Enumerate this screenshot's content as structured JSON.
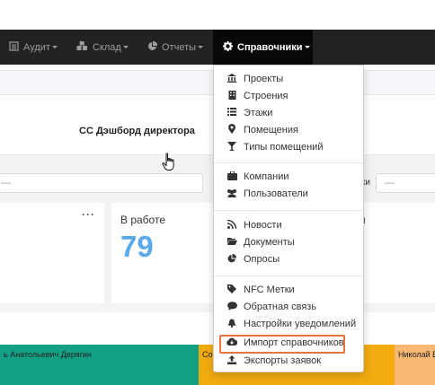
{
  "navbar": {
    "items": [
      {
        "label": "Аудит",
        "icon": "audit-icon"
      },
      {
        "label": "Склад",
        "icon": "warehouse-icon"
      },
      {
        "label": "Отчеты",
        "icon": "pie-chart-icon"
      },
      {
        "label": "Справочники",
        "icon": "gear-icon",
        "active": true
      }
    ]
  },
  "dashboard": {
    "title": "СС Дэшборд директора",
    "filter_left_value": "—",
    "filter_right_label": "ки",
    "filter_right_value": "—"
  },
  "cards": {
    "in_work_label": "В работе",
    "in_work_value": "79",
    "third_card_label_fragment": "ы",
    "menu_dots": "···"
  },
  "bars": [
    {
      "label": "ь Анатольевич Дерягин",
      "color": "#14a085"
    },
    {
      "label": "Со",
      "color": "#f2ac10"
    },
    {
      "label": "Николай Е",
      "color": "#f6b872"
    }
  ],
  "dropdown": {
    "items": [
      {
        "label": "Проекты",
        "icon": "institution-icon"
      },
      {
        "label": "Строения",
        "icon": "building-icon"
      },
      {
        "label": "Этажи",
        "icon": "list-icon"
      },
      {
        "label": "Помещения",
        "icon": "map-marker-icon"
      },
      {
        "label": "Типы помещений",
        "icon": "glass-icon"
      },
      {
        "label": "Компании",
        "icon": "briefcase-icon"
      },
      {
        "label": "Пользователи",
        "icon": "users-icon"
      },
      {
        "label": "Новости",
        "icon": "rss-icon"
      },
      {
        "label": "Документы",
        "icon": "folder-open-icon"
      },
      {
        "label": "Опросы",
        "icon": "pie-chart-icon"
      },
      {
        "label": "NFC Метки",
        "icon": "tag-icon"
      },
      {
        "label": "Обратная связь",
        "icon": "comment-icon"
      },
      {
        "label": "Настройки уведомлений",
        "icon": "bell-icon"
      },
      {
        "label": "Импорт справочников",
        "icon": "cloud-download-icon",
        "highlighted": true
      },
      {
        "label": "Экспорты заявок",
        "icon": "upload-icon"
      }
    ]
  },
  "colors": {
    "accent": "#5aa9ea",
    "highlight": "#e8763b",
    "navbar": "#222222"
  }
}
